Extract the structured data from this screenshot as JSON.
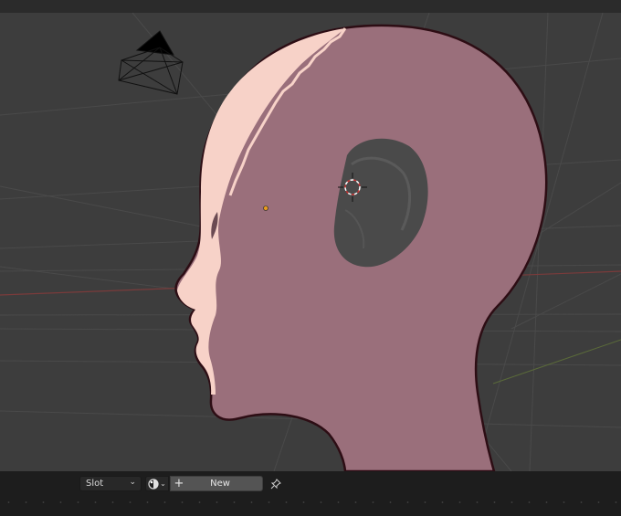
{
  "window": {
    "top_bar": ""
  },
  "viewport": {
    "object": "head",
    "icons": {
      "camera": "camera-object-icon",
      "light": "light-point-icon",
      "cursor": "3d-cursor-icon"
    },
    "colors": {
      "background": "#3d3d3d",
      "head_fill": "#9a6f7b",
      "head_highlight": "#f7d2c8",
      "outline": "#2d0d14",
      "ear": "#4a4a4a",
      "x_axis": "#7a3b3b",
      "grid": "#4c4c4c"
    }
  },
  "footer": {
    "slot_label": "Slot",
    "new_label": "New",
    "plus_icon": "plus-icon",
    "pin_icon": "pin-icon",
    "material_icon": "material-sphere-icon"
  }
}
